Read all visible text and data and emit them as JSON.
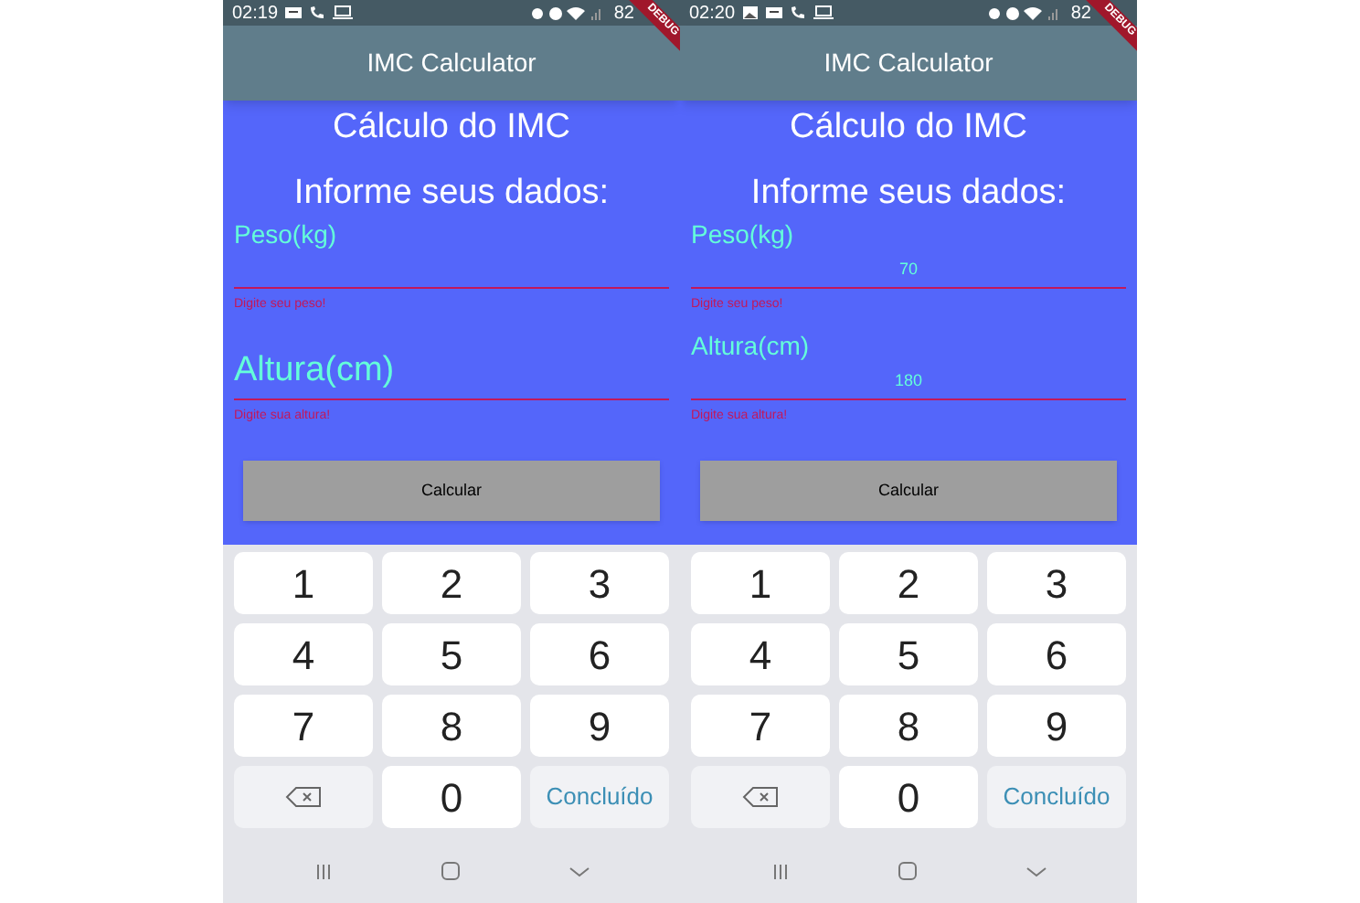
{
  "phones": [
    {
      "status": {
        "time": "02:19",
        "left_icons": [
          {
            "kind": "message"
          },
          {
            "kind": "phone"
          },
          {
            "kind": "laptop"
          }
        ],
        "battery": "82"
      },
      "debug_banner": "DEBUG",
      "app_title": "IMC Calculator",
      "heading": "Cálculo do IMC",
      "subheading": "Informe seus dados:",
      "fields": [
        {
          "label": "Peso(kg)",
          "floated": true,
          "error": "Digite seu peso!"
        },
        {
          "label": "Altura(cm)",
          "floated": false,
          "error": "Digite sua altura!"
        }
      ],
      "button": "Calcular",
      "keys": [
        {
          "kind": "digit",
          "label": "1"
        },
        {
          "kind": "digit",
          "label": "2"
        },
        {
          "kind": "digit",
          "label": "3"
        },
        {
          "kind": "digit",
          "label": "4"
        },
        {
          "kind": "digit",
          "label": "5"
        },
        {
          "kind": "digit",
          "label": "6"
        },
        {
          "kind": "digit",
          "label": "7"
        },
        {
          "kind": "digit",
          "label": "8"
        },
        {
          "kind": "digit",
          "label": "9"
        },
        {
          "kind": "backspace"
        },
        {
          "kind": "digit",
          "label": "0"
        },
        {
          "kind": "done",
          "label": "Concluído"
        }
      ]
    },
    {
      "status": {
        "time": "02:20",
        "left_icons": [
          {
            "kind": "image"
          },
          {
            "kind": "message"
          },
          {
            "kind": "phone"
          },
          {
            "kind": "laptop"
          }
        ],
        "battery": "82"
      },
      "debug_banner": "DEBUG",
      "app_title": "IMC Calculator",
      "heading": "Cálculo do IMC",
      "subheading": "Informe seus dados:",
      "fields": [
        {
          "label": "Peso(kg)",
          "floated": true,
          "value": "70",
          "error": "Digite seu peso!"
        },
        {
          "label": "Altura(cm)",
          "floated": true,
          "value": "180",
          "error": "Digite sua altura!"
        }
      ],
      "button": "Calcular",
      "keys": [
        {
          "kind": "digit",
          "label": "1"
        },
        {
          "kind": "digit",
          "label": "2"
        },
        {
          "kind": "digit",
          "label": "3"
        },
        {
          "kind": "digit",
          "label": "4"
        },
        {
          "kind": "digit",
          "label": "5"
        },
        {
          "kind": "digit",
          "label": "6"
        },
        {
          "kind": "digit",
          "label": "7"
        },
        {
          "kind": "digit",
          "label": "8"
        },
        {
          "kind": "digit",
          "label": "9"
        },
        {
          "kind": "backspace"
        },
        {
          "kind": "digit",
          "label": "0"
        },
        {
          "kind": "done",
          "label": "Concluído"
        }
      ]
    }
  ]
}
